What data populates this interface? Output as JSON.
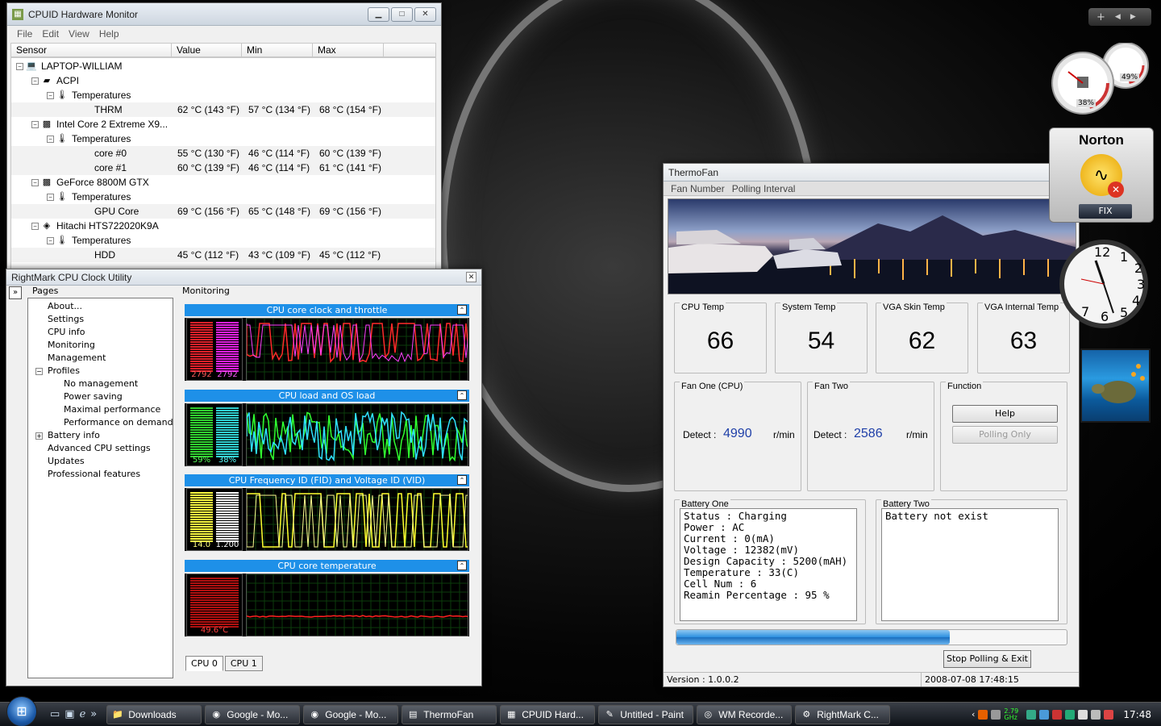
{
  "cpuid": {
    "title": "CPUID Hardware Monitor",
    "menu": [
      "File",
      "Edit",
      "View",
      "Help"
    ],
    "columns": [
      "Sensor",
      "Value",
      "Min",
      "Max"
    ],
    "tree": [
      {
        "label": "LAPTOP-WILLIAM",
        "value": "",
        "min": "",
        "max": ""
      },
      {
        "label": "ACPI",
        "value": "",
        "min": "",
        "max": ""
      },
      {
        "label": "Temperatures",
        "value": "",
        "min": "",
        "max": ""
      },
      {
        "label": "THRM",
        "value": "62 °C  (143 °F)",
        "min": "57 °C  (134 °F)",
        "max": "68 °C  (154 °F)"
      },
      {
        "label": "Intel Core 2 Extreme X9...",
        "value": "",
        "min": "",
        "max": ""
      },
      {
        "label": "Temperatures",
        "value": "",
        "min": "",
        "max": ""
      },
      {
        "label": "core #0",
        "value": "55 °C  (130 °F)",
        "min": "46 °C  (114 °F)",
        "max": "60 °C  (139 °F)"
      },
      {
        "label": "core #1",
        "value": "60 °C  (139 °F)",
        "min": "46 °C  (114 °F)",
        "max": "61 °C  (141 °F)"
      },
      {
        "label": "GeForce 8800M GTX",
        "value": "",
        "min": "",
        "max": ""
      },
      {
        "label": "Temperatures",
        "value": "",
        "min": "",
        "max": ""
      },
      {
        "label": "GPU Core",
        "value": "69 °C  (156 °F)",
        "min": "65 °C  (148 °F)",
        "max": "69 °C  (156 °F)"
      },
      {
        "label": "Hitachi HTS722020K9A",
        "value": "",
        "min": "",
        "max": ""
      },
      {
        "label": "Temperatures",
        "value": "",
        "min": "",
        "max": ""
      },
      {
        "label": "HDD",
        "value": "45 °C  (112 °F)",
        "min": "43 °C  (109 °F)",
        "max": "45 °C  (112 °F)"
      }
    ]
  },
  "rmclock": {
    "title": "RightMark CPU Clock Utility",
    "pages_label": "Pages",
    "monitoring_label": "Monitoring",
    "pages": [
      "About...",
      "Settings",
      "CPU info",
      "Monitoring",
      "Management",
      "Profiles",
      "No management",
      "Power saving",
      "Maximal performance",
      "Performance on demand",
      "Battery info",
      "Advanced CPU settings",
      "Updates",
      "Professional features"
    ],
    "panels": [
      {
        "title": "CPU core clock and throttle",
        "bar1": "2792",
        "bar2": "2792"
      },
      {
        "title": "CPU load and OS load",
        "bar1": "59%",
        "bar2": "38%"
      },
      {
        "title": "CPU Frequency ID (FID) and Voltage ID (VID)",
        "bar1": "14.0",
        "bar2": "1.200"
      },
      {
        "title": "CPU core temperature",
        "bar1": "49.6°C",
        "bar2": ""
      }
    ],
    "cpu_tabs": [
      "CPU 0",
      "CPU 1"
    ]
  },
  "thermofan": {
    "title": "ThermoFan",
    "menu": {
      "fan_number": "Fan Number",
      "polling_interval": "Polling Interval"
    },
    "temps": [
      {
        "label": "CPU Temp",
        "value": "66"
      },
      {
        "label": "System Temp",
        "value": "54"
      },
      {
        "label": "VGA Skin Temp",
        "value": "62"
      },
      {
        "label": "VGA Internal Temp",
        "value": "63"
      }
    ],
    "fan_one": {
      "label": "Fan One (CPU)",
      "detect": "Detect :",
      "value": "4990",
      "unit": "r/min"
    },
    "fan_two": {
      "label": "Fan Two",
      "detect": "Detect :",
      "value": "2586",
      "unit": "r/min"
    },
    "function": {
      "label": "Function",
      "help": "Help",
      "polling_only": "Polling Only"
    },
    "battery_one": {
      "label": "Battery One",
      "text": "Status : Charging\nPower : AC\nCurrent : 0(mA)\nVoltage : 12382(mV)\nDesign Capacity : 5200(mAH)\nTemperature : 33(C)\nCell Num : 6\nReamin Percentage : 95 %"
    },
    "battery_two": {
      "label": "Battery Two",
      "text": "Battery not exist"
    },
    "progress_fraction": 0.7,
    "stop_button": "Stop Polling & Exit",
    "version": "Version : 1.0.0.2",
    "datetime": "2008-07-08 17:48:15"
  },
  "gadgets": {
    "meter_cpu": "38%",
    "meter_mem": "49%",
    "norton_brand": "Norton",
    "norton_fix": "FIX",
    "clock_numerals": [
      "12",
      "1",
      "2",
      "3",
      "4",
      "5",
      "6",
      "7"
    ]
  },
  "taskbar": {
    "buttons": [
      {
        "label": "Downloads"
      },
      {
        "label": "Google - Mo..."
      },
      {
        "label": "Google - Mo..."
      },
      {
        "label": "ThermoFan"
      },
      {
        "label": "CPUID Hard..."
      },
      {
        "label": "Untitled - Paint"
      },
      {
        "label": "WM Recorde..."
      },
      {
        "label": "RightMark C..."
      }
    ],
    "tray_freq": "2.79 GHz",
    "clock": "17:48"
  }
}
